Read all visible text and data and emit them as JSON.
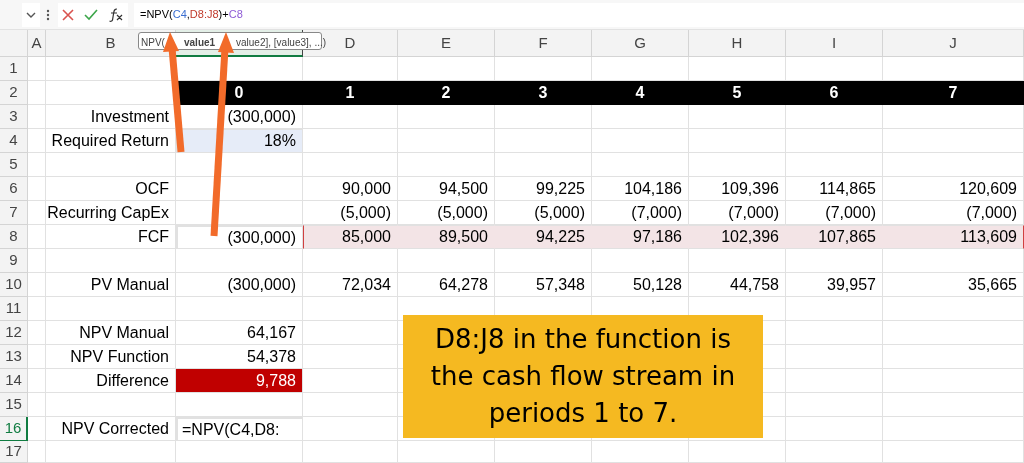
{
  "formula_bar": {
    "tokens": [
      {
        "text": "=NPV("
      },
      {
        "text": "C4",
        "color": "#3b6fd1"
      },
      {
        "text": ","
      },
      {
        "text": "D8:J8",
        "color": "#c0392b"
      },
      {
        "text": ")+"
      },
      {
        "text": "C8",
        "color": "#8e5bd6"
      }
    ]
  },
  "tooltip_parts": [
    "NPV(",
    "**value1**",
    "value2], [value3], ...)"
  ],
  "columns": [
    {
      "label": "A",
      "selected": false
    },
    {
      "label": "B",
      "selected": false
    },
    {
      "selected": true
    },
    {
      "label": "D",
      "selected": false
    },
    {
      "label": "E",
      "selected": false
    },
    {
      "label": "F",
      "selected": false
    },
    {
      "label": "G",
      "selected": false
    },
    {
      "label": "H",
      "selected": false
    },
    {
      "label": "I",
      "selected": false
    },
    {
      "label": "J",
      "selected": false
    }
  ],
  "rows": [
    {
      "number": "1",
      "selected": false
    },
    {
      "number": "2",
      "selected": false,
      "kind": "header",
      "cells": [
        null,
        {
          "text": "0"
        },
        {
          "text": "1"
        },
        {
          "text": "2"
        },
        {
          "text": "3"
        },
        {
          "text": "4"
        },
        {
          "text": "5"
        },
        {
          "text": "6"
        },
        {
          "text": "7"
        }
      ]
    },
    {
      "number": "3",
      "selected": false,
      "cells": [
        {
          "text": "Investment"
        },
        {
          "text": "(300,000)"
        }
      ]
    },
    {
      "number": "4",
      "selected": false,
      "cells": [
        {
          "text": "Required Return"
        },
        {
          "text": "18%",
          "kind": "rate"
        }
      ]
    },
    {
      "number": "5",
      "selected": false
    },
    {
      "number": "6",
      "selected": false,
      "cells": [
        {
          "text": "OCF"
        },
        null,
        {
          "text": "90,000"
        },
        {
          "text": "94,500"
        },
        {
          "text": "99,225"
        },
        {
          "text": "104,186"
        },
        {
          "text": "109,396"
        },
        {
          "text": "114,865"
        },
        {
          "text": "120,609"
        }
      ]
    },
    {
      "number": "7",
      "selected": false,
      "cells": [
        {
          "text": "Recurring CapEx"
        },
        null,
        {
          "text": "(5,000)"
        },
        {
          "text": "(5,000)"
        },
        {
          "text": "(5,000)"
        },
        {
          "text": "(7,000)"
        },
        {
          "text": "(7,000)"
        },
        {
          "text": "(7,000)"
        },
        {
          "text": "(7,000)"
        }
      ]
    },
    {
      "number": "8",
      "selected": false,
      "cells": [
        {
          "text": "FCF"
        },
        {
          "text": "(300,000)",
          "kind": "initial"
        },
        {
          "text": "85,000",
          "kind": "stream"
        },
        {
          "text": "89,500",
          "kind": "stream"
        },
        {
          "text": "94,225",
          "kind": "stream"
        },
        {
          "text": "97,186",
          "kind": "stream"
        },
        {
          "text": "102,396",
          "kind": "stream"
        },
        {
          "text": "107,865",
          "kind": "stream"
        },
        {
          "text": "113,609",
          "kind": "stream"
        }
      ]
    },
    {
      "number": "9",
      "selected": false
    },
    {
      "number": "10",
      "selected": false,
      "cells": [
        {
          "text": "PV Manual"
        },
        {
          "text": "(300,000)"
        },
        {
          "text": "72,034"
        },
        {
          "text": "64,278"
        },
        {
          "text": "57,348"
        },
        {
          "text": "50,128"
        },
        {
          "text": "44,758"
        },
        {
          "text": "39,957"
        },
        {
          "text": "35,665"
        }
      ]
    },
    {
      "number": "11",
      "selected": false
    },
    {
      "number": "12",
      "selected": false,
      "cells": [
        {
          "text": "NPV Manual"
        },
        {
          "text": "64,167"
        }
      ]
    },
    {
      "number": "13",
      "selected": false,
      "cells": [
        {
          "text": "NPV Function"
        },
        {
          "text": "54,378"
        }
      ]
    },
    {
      "number": "14",
      "selected": false,
      "cells": [
        {
          "text": "Difference"
        },
        {
          "text": "9,788",
          "kind": "alert"
        }
      ]
    },
    {
      "number": "15",
      "selected": false
    },
    {
      "number": "16",
      "selected": true,
      "cells": [
        {
          "text": "NPV Corrected"
        },
        {
          "text": "=NPV(C4,D8:",
          "kind": "editing"
        }
      ]
    },
    {
      "number": "17",
      "selected": false
    }
  ],
  "callout": "D8:J8 in the function is the cash flow stream in periods 1 to 7."
}
